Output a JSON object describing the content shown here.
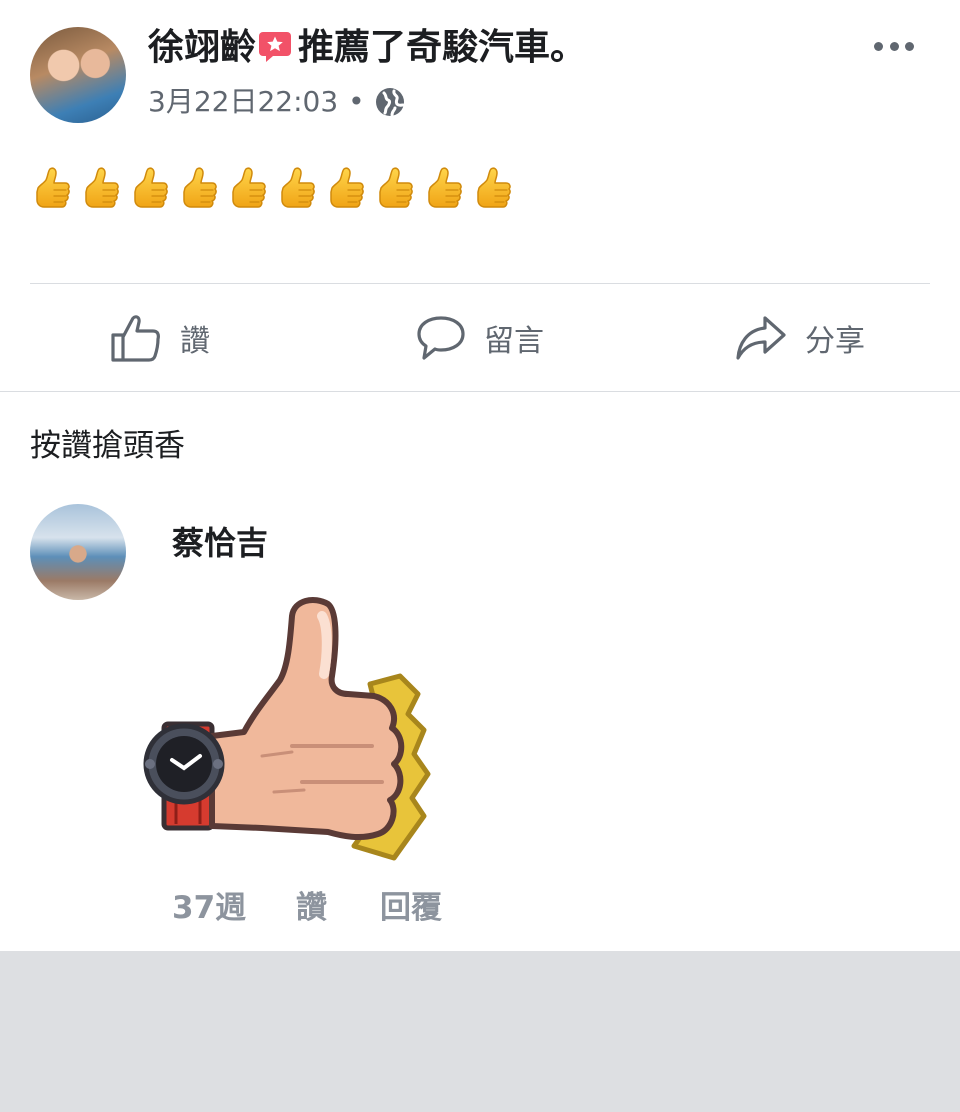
{
  "post": {
    "author": "徐翊齡",
    "action_text": "推薦了奇駿汽車。",
    "timestamp": "3月22日22:03",
    "separator": "•",
    "privacy_icon": "globe-icon",
    "more_icon": "more-dots-icon",
    "body_emoji": "thumbs-up-emoji",
    "body_emoji_count": 10
  },
  "actions": {
    "like": "讚",
    "comment": "留言",
    "share": "分享"
  },
  "comments": {
    "prompt": "按讚搶頭香",
    "items": [
      {
        "name": "蔡恰吉",
        "sticker": "thumbs-up-sticker",
        "time": "37週",
        "like": "讚",
        "reply": "回覆"
      }
    ]
  },
  "colors": {
    "text_primary": "#1c1e21",
    "text_secondary": "#606770",
    "text_meta": "#8d949e",
    "divider": "#dadde1",
    "footer_bg": "#dddfe2",
    "badge_red": "#f25268"
  }
}
